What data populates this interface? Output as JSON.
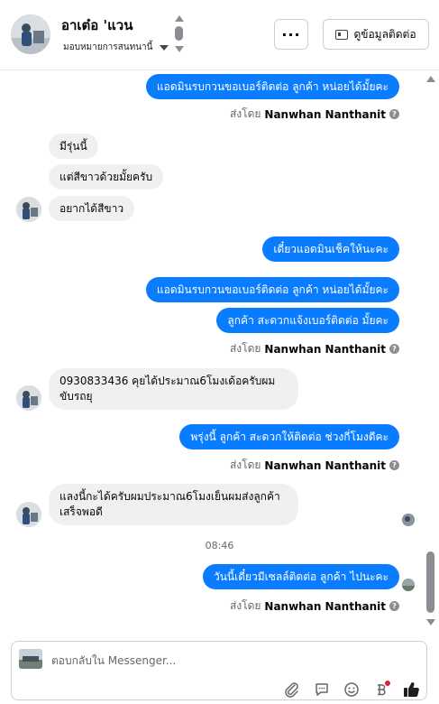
{
  "header": {
    "contact_name": "อาเต๋อ 'แวน",
    "assign_label": "มอบหมายการสนทนานี้",
    "more_label": "···",
    "contact_info_label": "ดูข้อมูลติดต่อ"
  },
  "messages": [
    {
      "id": "m1",
      "dir": "out",
      "text": "แอดมินรบกวนขอเบอร์ติดต่อ ลูกค้า หน่อยได้มั้ยคะ"
    },
    {
      "id": "s1",
      "dir": "meta",
      "prefix": "ส่งโดย",
      "name": "Nanwhan Nanthanit"
    },
    {
      "id": "m2",
      "dir": "in",
      "text": "มีรุ่นนี้"
    },
    {
      "id": "m3",
      "dir": "in",
      "text": "แต่สีขาวด้วยมั้ยครับ"
    },
    {
      "id": "m4",
      "dir": "in",
      "text": "อยากได้สีขาว"
    },
    {
      "id": "m5",
      "dir": "out",
      "text": "เดี๋ยวแอดมินเช็คให้นะคะ"
    },
    {
      "id": "m6",
      "dir": "out",
      "text": "แอดมินรบกวนขอเบอร์ติดต่อ ลูกค้า หน่อยได้มั้ยคะ"
    },
    {
      "id": "m7",
      "dir": "out",
      "text": "ลูกค้า สะดวกแจ้งเบอร์ติดต่อ มั้ยคะ"
    },
    {
      "id": "s2",
      "dir": "meta",
      "prefix": "ส่งโดย",
      "name": "Nanwhan Nanthanit"
    },
    {
      "id": "m8",
      "dir": "in",
      "text": "0930833436 คุยได้ประมาณ6โมงเด้อครับผมขับรถยุ"
    },
    {
      "id": "m9",
      "dir": "out",
      "text": "พรุ่งนี้ ลูกค้า สะดวกให้ติดต่อ ช่วงกี่โมงดีคะ"
    },
    {
      "id": "s3",
      "dir": "meta",
      "prefix": "ส่งโดย",
      "name": "Nanwhan Nanthanit"
    },
    {
      "id": "m10",
      "dir": "in",
      "text": "แลงนี้กะได้ครับผมประมาณ6โมงเย็นผมส่งลูกค้าเสร็จพอดี"
    },
    {
      "id": "t1",
      "dir": "time",
      "text": "08:46"
    },
    {
      "id": "m11",
      "dir": "out",
      "text": "วันนี้เดี๋ยวมีเซลล์ติดต่อ ลูกค้า ไปนะคะ"
    },
    {
      "id": "s4",
      "dir": "meta",
      "prefix": "ส่งโดย",
      "name": "Nanwhan Nanthanit"
    }
  ],
  "composer": {
    "placeholder": "ตอบกลับใน Messenger...",
    "toolbar_icons": [
      "paperclip-icon",
      "chat-bubble-icon",
      "emoji-icon",
      "baht-icon",
      "thumbs-up-icon"
    ]
  },
  "colors": {
    "outgoing_bubble": "#0a7cff",
    "incoming_bubble": "#f0f0f0",
    "muted_text": "#65676b",
    "notification_dot": "#e41e3f"
  }
}
